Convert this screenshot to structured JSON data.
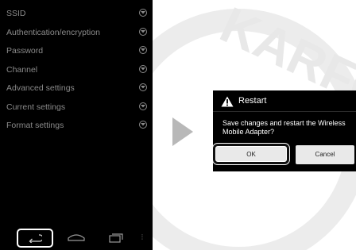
{
  "settings_menu": {
    "items": [
      {
        "label": "SSID"
      },
      {
        "label": "Authentication/encryption"
      },
      {
        "label": "Password"
      },
      {
        "label": "Channel"
      },
      {
        "label": "Advanced settings"
      },
      {
        "label": "Current settings"
      },
      {
        "label": "Format settings"
      }
    ]
  },
  "navbar": {
    "buttons": [
      "back-icon",
      "home-icon",
      "recent-apps-icon",
      "menu-dots-icon"
    ],
    "menu_glyph": "⋮"
  },
  "dialog": {
    "title": "Restart",
    "message": "Save changes and restart the Wireless Mobile Adapter?",
    "ok_label": "OK",
    "cancel_label": "Cancel"
  },
  "watermark_text": "KARFO",
  "colors": {
    "screen_bg": "#000000",
    "menu_text": "#8a8a8a",
    "dialog_text": "#ffffff",
    "button_bg": "#e9e9e9",
    "arrow": "#b8b8b8",
    "highlight_outline": "#111111"
  }
}
